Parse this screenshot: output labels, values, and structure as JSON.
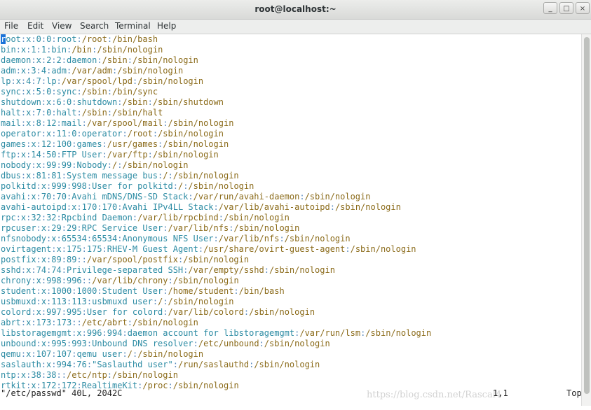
{
  "window": {
    "title": "root@localhost:~",
    "controls": {
      "minimize": "_",
      "maximize": "□",
      "close": "×"
    }
  },
  "menu": [
    "File",
    "Edit",
    "View",
    "Search",
    "Terminal",
    "Help"
  ],
  "colors": {
    "field": "#2d8ca4",
    "separator": "#5a8bbf",
    "shell": "#8b6b1a",
    "cursor": "#1a73d9",
    "text": "#222222"
  },
  "lines": [
    "root:x:0:0:root:/root:/bin/bash",
    "bin:x:1:1:bin:/bin:/sbin/nologin",
    "daemon:x:2:2:daemon:/sbin:/sbin/nologin",
    "adm:x:3:4:adm:/var/adm:/sbin/nologin",
    "lp:x:4:7:lp:/var/spool/lpd:/sbin/nologin",
    "sync:x:5:0:sync:/sbin:/bin/sync",
    "shutdown:x:6:0:shutdown:/sbin:/sbin/shutdown",
    "halt:x:7:0:halt:/sbin:/sbin/halt",
    "mail:x:8:12:mail:/var/spool/mail:/sbin/nologin",
    "operator:x:11:0:operator:/root:/sbin/nologin",
    "games:x:12:100:games:/usr/games:/sbin/nologin",
    "ftp:x:14:50:FTP User:/var/ftp:/sbin/nologin",
    "nobody:x:99:99:Nobody:/:/sbin/nologin",
    "dbus:x:81:81:System message bus:/:/sbin/nologin",
    "polkitd:x:999:998:User for polkitd:/:/sbin/nologin",
    "avahi:x:70:70:Avahi mDNS/DNS-SD Stack:/var/run/avahi-daemon:/sbin/nologin",
    "avahi-autoipd:x:170:170:Avahi IPv4LL Stack:/var/lib/avahi-autoipd:/sbin/nologin",
    "rpc:x:32:32:Rpcbind Daemon:/var/lib/rpcbind:/sbin/nologin",
    "rpcuser:x:29:29:RPC Service User:/var/lib/nfs:/sbin/nologin",
    "nfsnobody:x:65534:65534:Anonymous NFS User:/var/lib/nfs:/sbin/nologin",
    "ovirtagent:x:175:175:RHEV-M Guest Agent:/usr/share/ovirt-guest-agent:/sbin/nologin",
    "postfix:x:89:89::/var/spool/postfix:/sbin/nologin",
    "sshd:x:74:74:Privilege-separated SSH:/var/empty/sshd:/sbin/nologin",
    "chrony:x:998:996::/var/lib/chrony:/sbin/nologin",
    "student:x:1000:1000:Student User:/home/student:/bin/bash",
    "usbmuxd:x:113:113:usbmuxd user:/:/sbin/nologin",
    "colord:x:997:995:User for colord:/var/lib/colord:/sbin/nologin",
    "abrt:x:173:173::/etc/abrt:/sbin/nologin",
    "libstoragemgmt:x:996:994:daemon account for libstoragemgmt:/var/run/lsm:/sbin/nologin",
    "unbound:x:995:993:Unbound DNS resolver:/etc/unbound:/sbin/nologin",
    "qemu:x:107:107:qemu user:/:/sbin/nologin",
    "saslauth:x:994:76:\"Saslauthd user\":/run/saslauthd:/sbin/nologin",
    "ntp:x:38:38::/etc/ntp:/sbin/nologin",
    "rtkit:x:172:172:RealtimeKit:/proc:/sbin/nologin"
  ],
  "status": {
    "file_info": "\"/etc/passwd\" 40L, 2042C",
    "position": "1,1",
    "scroll": "Top"
  },
  "watermark": "https://blog.csdn.net/Rascal4"
}
